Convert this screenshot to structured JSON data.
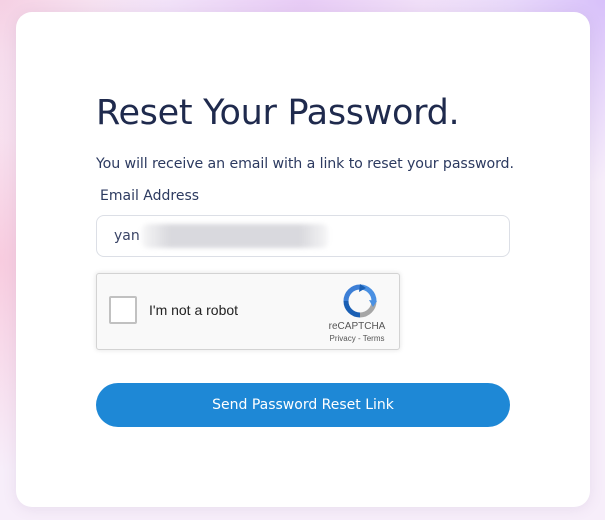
{
  "form": {
    "title": "Reset Your Password.",
    "subtitle": "You will receive an email with a link to reset your password.",
    "email_label": "Email Address",
    "email_value_visible": "yan",
    "submit_label": "Send Password Reset Link"
  },
  "recaptcha": {
    "checkbox_label": "I'm not a robot",
    "brand": "reCAPTCHA",
    "privacy_link": "Privacy",
    "separator": "-",
    "terms_link": "Terms"
  },
  "colors": {
    "primary": "#1e88d6",
    "title_text": "#1f2a4d",
    "body_text": "#2c3a60"
  }
}
